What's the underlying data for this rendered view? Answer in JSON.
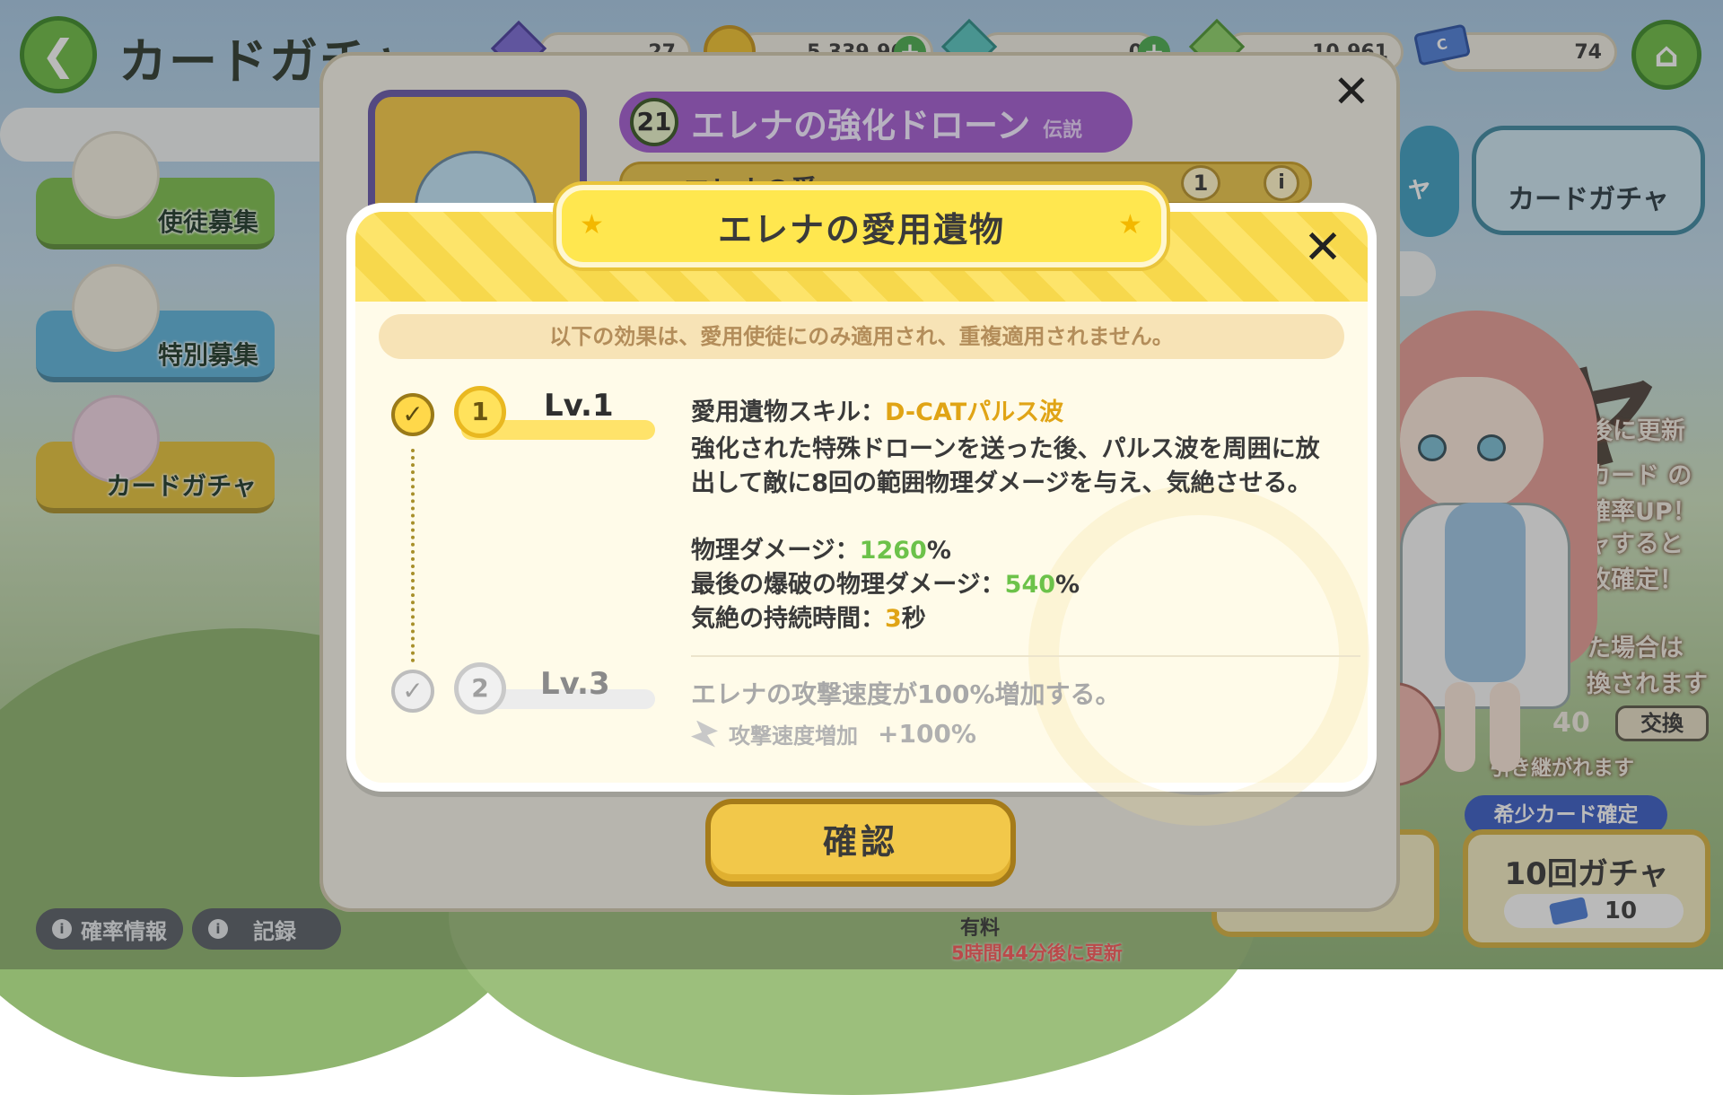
{
  "header": {
    "title": "カードガチャ",
    "resources": [
      {
        "name": "gem-a",
        "value": "27"
      },
      {
        "name": "gold",
        "value": "5,339,961"
      },
      {
        "name": "gem-b",
        "value": "0"
      },
      {
        "name": "gem-c",
        "value": "10,961"
      },
      {
        "name": "ticket",
        "value": "74"
      }
    ]
  },
  "sidebar": {
    "items": [
      {
        "label": "使徒募集"
      },
      {
        "label": "特別募集"
      },
      {
        "label": "カードガチャ"
      }
    ],
    "bottom": [
      {
        "label": "確率情報"
      },
      {
        "label": "記録"
      }
    ]
  },
  "right": {
    "card_gacha_label": "カードガチャ",
    "side_tab_partial": "ャ",
    "big_title_partial": "チャ",
    "ribbon_lines": [
      "後に更新",
      "カード の",
      "確率UP！",
      "ャすると",
      "枚確定！",
      "た場合は",
      "換されます",
      "引き継がれます"
    ],
    "ticket_partial": "40",
    "exchange_label": "交換",
    "rare_tag": "希少カード確定",
    "gacha10_label": "10回ガチャ",
    "gacha10_cost": "10",
    "paid_label": "有料",
    "refresh_note": "5時間44分後に更新"
  },
  "back_panel": {
    "level": "21",
    "drone_name": "エレナの強化ドローン",
    "rarity": "伝説",
    "sub_text": "エレナの愛",
    "count": "1",
    "info": "i",
    "close": "✕"
  },
  "dialog": {
    "title": "エレナの愛用遺物",
    "close": "✕",
    "notice": "以下の効果は、愛用使徒にのみ適用され、重複適用されません。",
    "levels": [
      {
        "seal": "1",
        "label": "Lv.1",
        "active": true,
        "skill_prefix": "愛用遺物スキル：",
        "skill_name": "D-CATパルス波",
        "description": "強化された特殊ドローンを送った後、パルス波を周囲に放出して敵に8回の範囲物理ダメージを与え、気絶させる。",
        "stats": [
          {
            "label": "物理ダメージ：",
            "value": "1260",
            "unit": "%"
          },
          {
            "label": "最後の爆破の物理ダメージ：",
            "value": "540",
            "unit": "%"
          },
          {
            "label": "気絶の持続時間：",
            "value": "3",
            "unit": "秒"
          }
        ]
      },
      {
        "seal": "2",
        "label": "Lv.3",
        "active": false,
        "description": "エレナの攻撃速度が100%増加する。",
        "buff_label": "攻撃速度増加",
        "buff_value": "+100%"
      }
    ],
    "confirm": "確認"
  },
  "colors": {
    "accent_yellow": "#ffe74f",
    "skill_name": "#e0a415",
    "stat_green": "#6cc24a",
    "purple_banner": "#a35fce",
    "nav_green": "#6fbf46"
  }
}
